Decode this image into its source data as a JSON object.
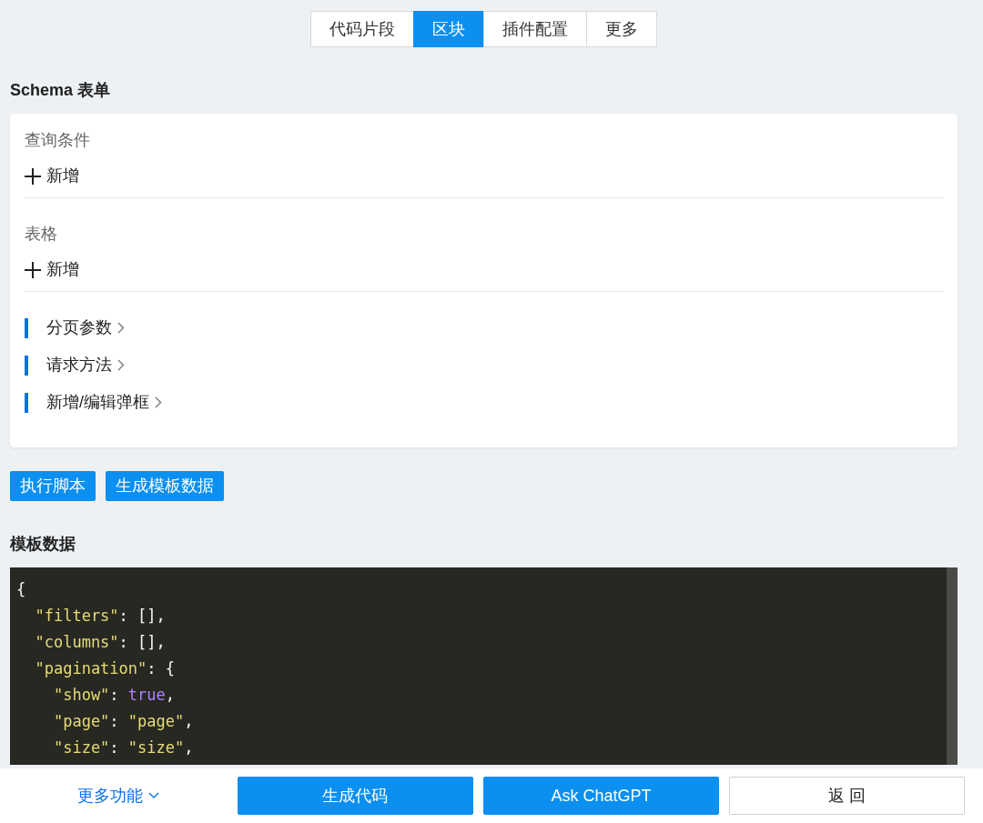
{
  "tabs": [
    {
      "label": "代码片段",
      "selected": false
    },
    {
      "label": "区块",
      "selected": true
    },
    {
      "label": "插件配置",
      "selected": false
    },
    {
      "label": "更多",
      "selected": false
    }
  ],
  "schema_form": {
    "title": "Schema 表单",
    "sections": [
      {
        "label": "查询条件",
        "add_label": "新增"
      },
      {
        "label": "表格",
        "add_label": "新增"
      }
    ],
    "groups": [
      {
        "label": "分页参数"
      },
      {
        "label": "请求方法"
      },
      {
        "label": "新增/编辑弹框"
      }
    ]
  },
  "actions": [
    "执行脚本",
    "生成模板数据"
  ],
  "template_data": {
    "title": "模板数据",
    "lines": [
      [
        {
          "kind": "punct",
          "text": "{"
        }
      ],
      [
        {
          "kind": "string",
          "text": "  \"filters\""
        },
        {
          "kind": "punct",
          "text": ": [],"
        }
      ],
      [
        {
          "kind": "string",
          "text": "  \"columns\""
        },
        {
          "kind": "punct",
          "text": ": [],"
        }
      ],
      [
        {
          "kind": "string",
          "text": "  \"pagination\""
        },
        {
          "kind": "punct",
          "text": ": {"
        }
      ],
      [
        {
          "kind": "string",
          "text": "    \"show\""
        },
        {
          "kind": "punct",
          "text": ": "
        },
        {
          "kind": "bool",
          "text": "true"
        },
        {
          "kind": "punct",
          "text": ","
        }
      ],
      [
        {
          "kind": "string",
          "text": "    \"page\""
        },
        {
          "kind": "punct",
          "text": ": "
        },
        {
          "kind": "string",
          "text": "\"page\""
        },
        {
          "kind": "punct",
          "text": ","
        }
      ],
      [
        {
          "kind": "string",
          "text": "    \"size\""
        },
        {
          "kind": "punct",
          "text": ": "
        },
        {
          "kind": "string",
          "text": "\"size\""
        },
        {
          "kind": "punct",
          "text": ","
        }
      ]
    ]
  },
  "footer": {
    "more_label": "更多功能",
    "buttons": [
      {
        "label": "生成代码",
        "kind": "primary"
      },
      {
        "label": "Ask ChatGPT",
        "kind": "primary"
      },
      {
        "label": "返 回",
        "kind": "default"
      }
    ]
  }
}
